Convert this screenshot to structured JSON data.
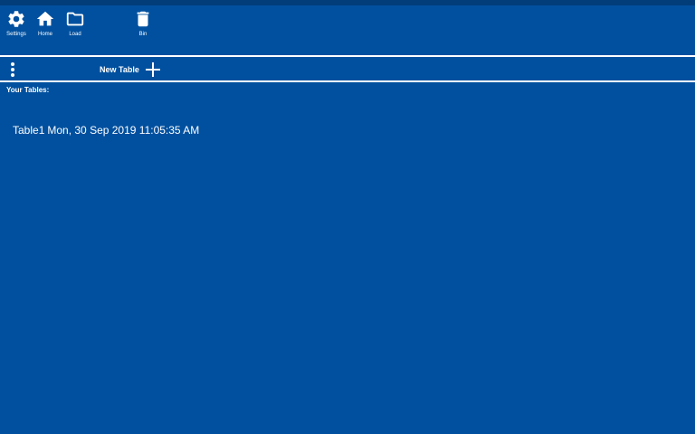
{
  "toolbar": {
    "settings_label": "Settings",
    "home_label": "Home",
    "load_label": "Load",
    "bin_label": "Bin"
  },
  "icons": {
    "settings": "gear-icon",
    "home": "home-icon",
    "load": "folder-icon",
    "bin": "trash-icon",
    "more": "vertical-dots-icon",
    "new_table": "plus-icon"
  },
  "actions": {
    "new_table_label": "New Table"
  },
  "tables": {
    "heading": "Your Tables:",
    "items": [
      {
        "name": "Table1",
        "created": "Mon, 30 Sep 2019 11:05:35 AM"
      }
    ]
  },
  "colors": {
    "background": "#01509f",
    "status_strip": "#023d7a",
    "foreground": "#ffffff"
  }
}
